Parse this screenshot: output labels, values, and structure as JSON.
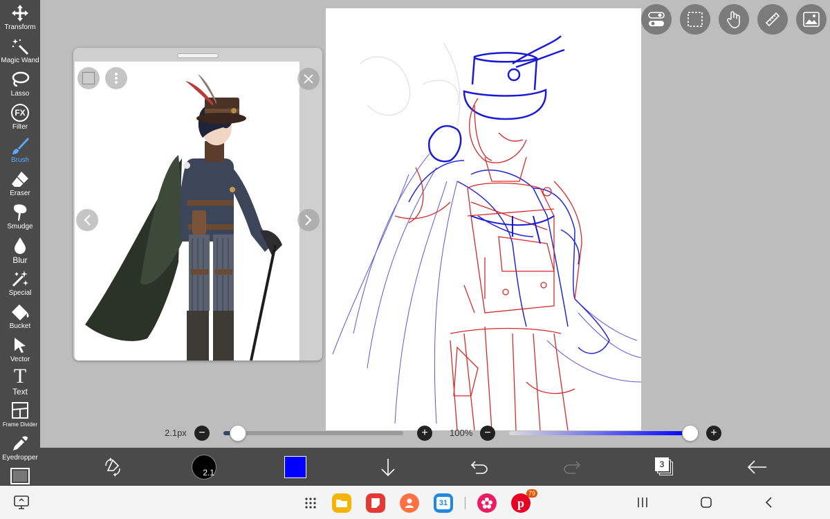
{
  "toolbar": {
    "tools": [
      {
        "label": "Transform",
        "icon": "move-arrows-icon"
      },
      {
        "label": "Magic Wand",
        "icon": "magic-wand-icon"
      },
      {
        "label": "Lasso",
        "icon": "lasso-icon"
      },
      {
        "label": "Filter",
        "icon": "fx-icon",
        "glyph": "FX"
      },
      {
        "label": "Brush",
        "icon": "brush-icon",
        "active": true
      },
      {
        "label": "Eraser",
        "icon": "eraser-icon"
      },
      {
        "label": "Smudge",
        "icon": "smudge-icon"
      },
      {
        "label": "Blur",
        "icon": "droplet-icon"
      },
      {
        "label": "Special",
        "icon": "sparkle-brush-icon"
      },
      {
        "label": "Bucket",
        "icon": "bucket-icon"
      },
      {
        "label": "Vector",
        "icon": "cursor-arrow-icon"
      },
      {
        "label": "Text",
        "icon": "text-t-icon",
        "glyph": "T"
      },
      {
        "label": "Frame Divider",
        "icon": "frame-divider-icon"
      },
      {
        "label": "Eyedropper",
        "icon": "eyedropper-icon"
      }
    ],
    "accent_color": "#5aa9ff"
  },
  "reference_window": {
    "icons": [
      "layer-thumb-icon",
      "more-vertical-icon",
      "close-icon",
      "prev-arrow-icon",
      "next-arrow-icon"
    ]
  },
  "top_right_buttons": [
    "toggle-icon",
    "selection-icon",
    "hand-touch-icon",
    "ruler-icon",
    "image-icon"
  ],
  "brush_size": {
    "label": "2.1px",
    "value": 2.1,
    "fraction": 0.08
  },
  "opacity": {
    "label": "100%",
    "value": 100,
    "fraction": 1.0
  },
  "action_bar": {
    "brush_preview_text": "2.1",
    "current_color": "#0000ff",
    "layers_count": "3"
  },
  "navbar": {
    "apps": [
      {
        "name": "files",
        "color": "#f5b400"
      },
      {
        "name": "notes",
        "color": "#e53935"
      },
      {
        "name": "contacts",
        "color": "#ff7043"
      },
      {
        "name": "calendar",
        "color": "#1e88e5",
        "text": "31"
      },
      {
        "name": "blossom",
        "color": "#e91e63"
      },
      {
        "name": "pinterest",
        "color": "#e60023",
        "badge": "79"
      }
    ]
  }
}
